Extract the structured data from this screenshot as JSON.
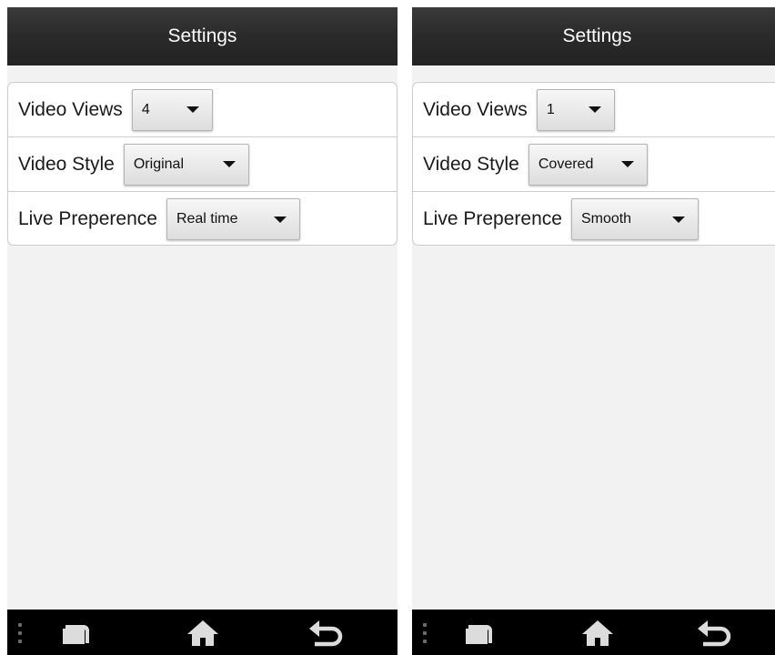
{
  "screens": [
    {
      "title": "Settings",
      "rows": [
        {
          "label": "Video Views",
          "value": "4"
        },
        {
          "label": "Video Style",
          "value": "Original"
        },
        {
          "label": "Live Preperence",
          "value": "Real time"
        }
      ]
    },
    {
      "title": "Settings",
      "rows": [
        {
          "label": "Video Views",
          "value": "1"
        },
        {
          "label": "Video Style",
          "value": "Covered"
        },
        {
          "label": "Live Preperence",
          "value": "Smooth"
        }
      ]
    }
  ],
  "icons": {
    "dropdown": "chevron-down-icon",
    "menu": "overflow-menu-icon",
    "recent": "recent-apps-icon",
    "home": "home-icon",
    "back": "back-icon"
  },
  "colors": {
    "titlebar": "#2a2a2a",
    "background": "#f2f2f2",
    "navbar": "#000000"
  }
}
